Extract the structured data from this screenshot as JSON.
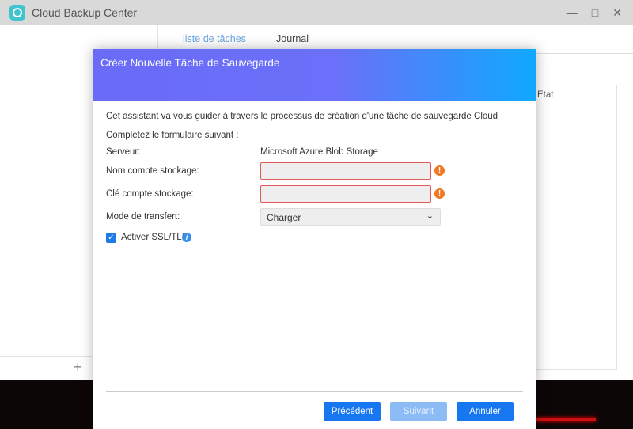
{
  "app": {
    "title": "Cloud Backup Center",
    "tabs": [
      "liste de tâches",
      "Journal"
    ],
    "table_header": "Etat",
    "add_label": "+",
    "window_buttons": {
      "minimize": "—",
      "maximize": "□",
      "close": "✕"
    }
  },
  "dialog": {
    "title": "Créer Nouvelle Tâche de Sauvegarde",
    "intro": "Cet assistant va vous guider à travers le processus de création d'une tâche de sauvegarde Cloud",
    "instruction": "Complétez le formulaire suivant :",
    "server_label": "Serveur:",
    "server_value": "Microsoft Azure Blob Storage",
    "account_name_label": "Nom compte stockage:",
    "account_name_value": "",
    "account_key_label": "Clé compte stockage:",
    "account_key_value": "",
    "transfer_label": "Mode de transfert:",
    "transfer_value": "Charger",
    "ssl_label": "Activer SSL/TLS",
    "ssl_checked": true,
    "buttons": {
      "previous": "Précédent",
      "next": "Suivant",
      "cancel": "Annuler"
    }
  },
  "colors": {
    "accent": "#1677f0",
    "warning": "#f07a24",
    "error_border": "#e05a5a"
  }
}
